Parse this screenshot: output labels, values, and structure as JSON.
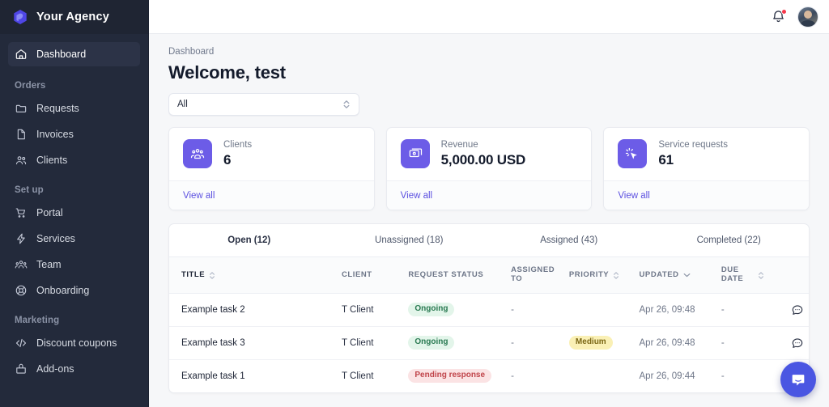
{
  "brand": {
    "name": "Your Agency",
    "logo_icon": "hexagon-logo-icon",
    "accent": "#6c5ce7"
  },
  "sidebar": {
    "dashboard": {
      "label": "Dashboard",
      "icon": "home-icon"
    },
    "sections": [
      {
        "title": "Orders",
        "items": [
          {
            "label": "Requests",
            "icon": "folder-icon"
          },
          {
            "label": "Invoices",
            "icon": "document-icon"
          },
          {
            "label": "Clients",
            "icon": "users-icon"
          }
        ]
      },
      {
        "title": "Set up",
        "items": [
          {
            "label": "Portal",
            "icon": "cart-icon"
          },
          {
            "label": "Services",
            "icon": "bolt-icon"
          },
          {
            "label": "Team",
            "icon": "team-icon"
          },
          {
            "label": "Onboarding",
            "icon": "lifebuoy-icon"
          }
        ]
      },
      {
        "title": "Marketing",
        "items": [
          {
            "label": "Discount coupons",
            "icon": "code-icon"
          },
          {
            "label": "Add-ons",
            "icon": "bag-icon"
          }
        ]
      }
    ]
  },
  "topbar": {
    "notifications_icon": "bell-icon",
    "has_unread": true,
    "avatar": "user-avatar"
  },
  "page": {
    "breadcrumb": "Dashboard",
    "title": "Welcome, test",
    "filter": {
      "value": "All",
      "icon": "chevron-updown-icon"
    }
  },
  "cards": [
    {
      "label": "Clients",
      "value": "6",
      "icon": "clients-icon",
      "link": "View all"
    },
    {
      "label": "Revenue",
      "value": "5,000.00 USD",
      "icon": "money-icon",
      "link": "View all"
    },
    {
      "label": "Service requests",
      "value": "61",
      "icon": "cursor-click-icon",
      "link": "View all"
    }
  ],
  "tabs": [
    {
      "label": "Open (12)",
      "active": true
    },
    {
      "label": "Unassigned (18)",
      "active": false
    },
    {
      "label": "Assigned (43)",
      "active": false
    },
    {
      "label": "Completed (22)",
      "active": false
    }
  ],
  "table": {
    "columns": [
      {
        "label": "TITLE",
        "sort": "updown"
      },
      {
        "label": "CLIENT",
        "sort": "none"
      },
      {
        "label": "REQUEST STATUS",
        "sort": "none"
      },
      {
        "label": "ASSIGNED TO",
        "sort": "none"
      },
      {
        "label": "PRIORITY",
        "sort": "updown"
      },
      {
        "label": "UPDATED",
        "sort": "down"
      },
      {
        "label": "DUE DATE",
        "sort": "updown"
      }
    ],
    "rows": [
      {
        "title": "Example task 2",
        "client": "T Client",
        "status": "Ongoing",
        "status_color": "green",
        "assigned_to": "-",
        "priority": "",
        "priority_color": "none",
        "updated": "Apr 26, 09:48",
        "due_date": "-",
        "action_icon": "chat-icon"
      },
      {
        "title": "Example task 3",
        "client": "T Client",
        "status": "Ongoing",
        "status_color": "green",
        "assigned_to": "-",
        "priority": "Medium",
        "priority_color": "yellow",
        "updated": "Apr 26, 09:48",
        "due_date": "-",
        "action_icon": "chat-icon"
      },
      {
        "title": "Example task 1",
        "client": "T Client",
        "status": "Pending response",
        "status_color": "red",
        "assigned_to": "-",
        "priority": "",
        "priority_color": "none",
        "updated": "Apr 26, 09:44",
        "due_date": "-",
        "action_icon": "chat-icon"
      }
    ]
  },
  "intercom": {
    "icon": "messenger-icon",
    "color": "#4a56e2"
  }
}
